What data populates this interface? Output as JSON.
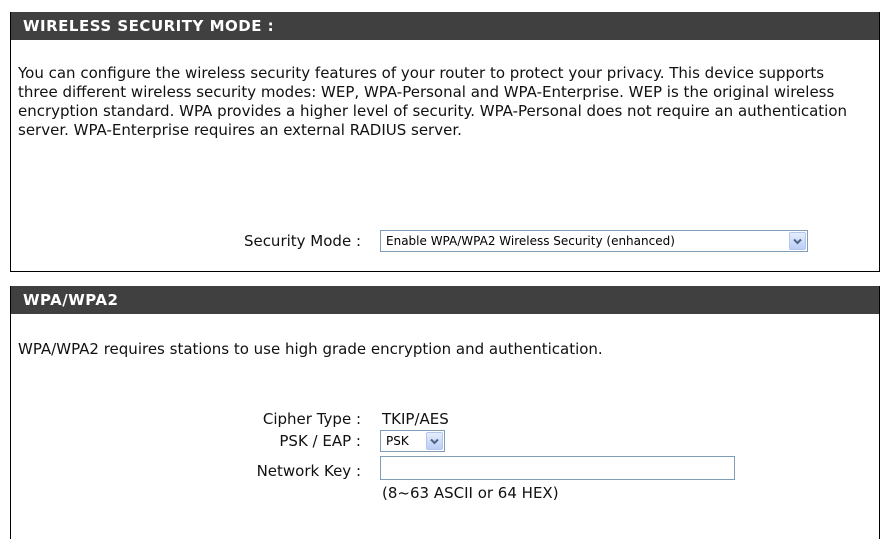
{
  "security_mode_section": {
    "header": "WIRELESS SECURITY MODE :",
    "description": "You can configure the wireless security features of your router to protect your privacy. This device supports three different wireless security modes: WEP, WPA-Personal and WPA-Enterprise. WEP is the original wireless encryption standard. WPA provides a higher level of security. WPA-Personal does not require an authentication server. WPA-Enterprise requires an external RADIUS server.",
    "security_mode_label": "Security Mode :",
    "security_mode_value": "Enable WPA/WPA2 Wireless Security (enhanced)"
  },
  "wpa_section": {
    "header": "WPA/WPA2",
    "description": "WPA/WPA2 requires stations to use high grade encryption and authentication.",
    "cipher_type_label": "Cipher Type :",
    "cipher_type_value": "TKIP/AES",
    "psk_eap_label": "PSK / EAP :",
    "psk_eap_value": "PSK",
    "network_key_label": "Network Key :",
    "network_key_value": "",
    "network_key_hint": "(8~63 ASCII or 64 HEX)"
  },
  "colors": {
    "header_bg": "#404040",
    "header_text": "#ffffff",
    "select_border": "#7f9db9",
    "dropdown_arrow": "#4d6185"
  },
  "icons": [
    "chevron-down-icon"
  ]
}
